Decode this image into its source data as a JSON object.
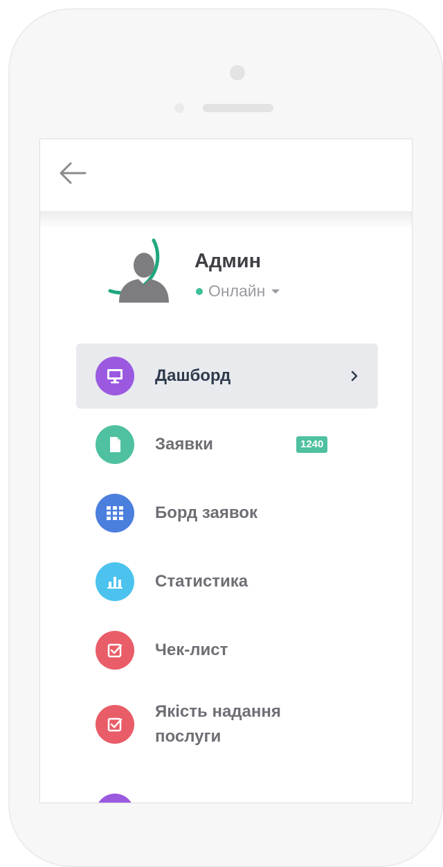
{
  "profile": {
    "name": "Админ",
    "status": "Онлайн",
    "status_color": "#3dbf97",
    "ring_color": "#1fa77f"
  },
  "menu": {
    "items": [
      {
        "label": "Дашборд",
        "icon": "monitor-icon",
        "color": "#9b59e0",
        "active": true
      },
      {
        "label": "Заявки",
        "icon": "document-icon",
        "color": "#4fc1a0",
        "badge": "1240",
        "badge_color": "#4fc1a0"
      },
      {
        "label": "Борд заявок",
        "icon": "grid-icon",
        "color": "#4b7fde"
      },
      {
        "label": "Статистика",
        "icon": "bar-chart-icon",
        "color": "#4cc3ee"
      },
      {
        "label": "Чек-лист",
        "icon": "checkbox-icon",
        "color": "#e95d68"
      },
      {
        "label": "Якість надання послуги",
        "icon": "checkbox-icon",
        "color": "#e95d68"
      }
    ],
    "partial_item_color": "#9b59e0"
  }
}
